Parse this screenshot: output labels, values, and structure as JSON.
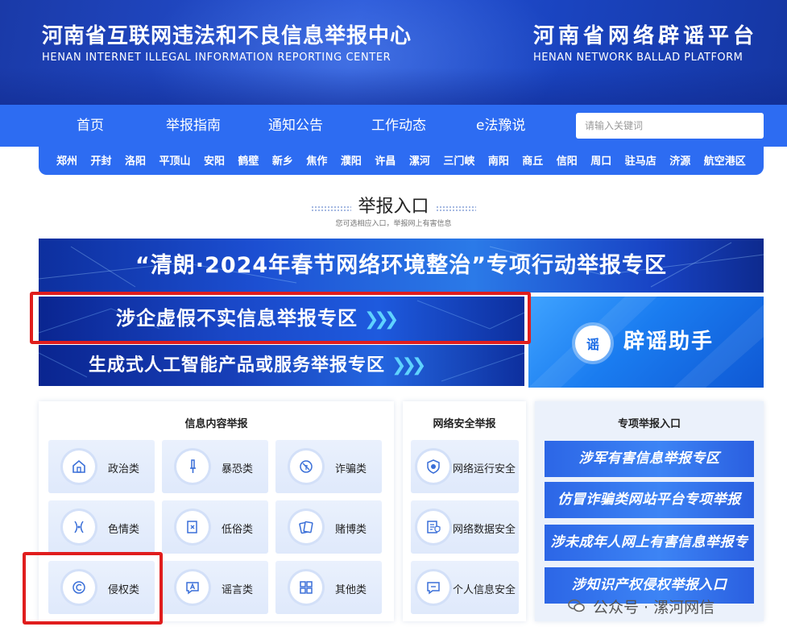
{
  "header": {
    "left_cn": "河南省互联网违法和不良信息举报中心",
    "left_en": "HENAN INTERNET ILLEGAL INFORMATION REPORTING CENTER",
    "right_cn": "河南省网络辟谣平台",
    "right_en": "HENAN NETWORK BALLAD PLATFORM"
  },
  "nav": {
    "items": [
      "首页",
      "举报指南",
      "通知公告",
      "工作动态",
      "e法豫说"
    ],
    "search_placeholder": "请输入关键词"
  },
  "cities": [
    "郑州",
    "开封",
    "洛阳",
    "平顶山",
    "安阳",
    "鹤壁",
    "新乡",
    "焦作",
    "濮阳",
    "许昌",
    "漯河",
    "三门峡",
    "南阳",
    "商丘",
    "信阳",
    "周口",
    "驻马店",
    "济源",
    "航空港区"
  ],
  "section": {
    "title": "举报入口",
    "subtitle": "您可选相应入口，举报网上有害信息"
  },
  "banners": {
    "qinglang": "“清朗·2024年春节网络环境整治”专项行动举报专区",
    "enterprise": "涉企虚假不实信息举报专区",
    "ai": "生成式人工智能产品或服务举报专区",
    "rumor": "辟谣助手",
    "rumor_badge": "谣"
  },
  "info_panel": {
    "title": "信息内容举报",
    "items": [
      "政治类",
      "暴恐类",
      "诈骗类",
      "色情类",
      "低俗类",
      "赌博类",
      "侵权类",
      "谣言类",
      "其他类"
    ]
  },
  "security_panel": {
    "title": "网络安全举报",
    "items": [
      "网络运行安全",
      "网络数据安全",
      "个人信息安全"
    ]
  },
  "special_panel": {
    "title": "专项举报入口",
    "items": [
      "涉军有害信息举报专区",
      "仿冒诈骗类网站平台专项举报",
      "涉未成年人网上有害信息举报专区",
      "涉知识产权侵权举报入口"
    ]
  },
  "watermark": {
    "text": "公众号 · 漯河网信"
  },
  "colors": {
    "nav_blue": "#2d6cf2",
    "header_blue": "#1a3aa8",
    "highlight_red": "#e01d1d"
  }
}
